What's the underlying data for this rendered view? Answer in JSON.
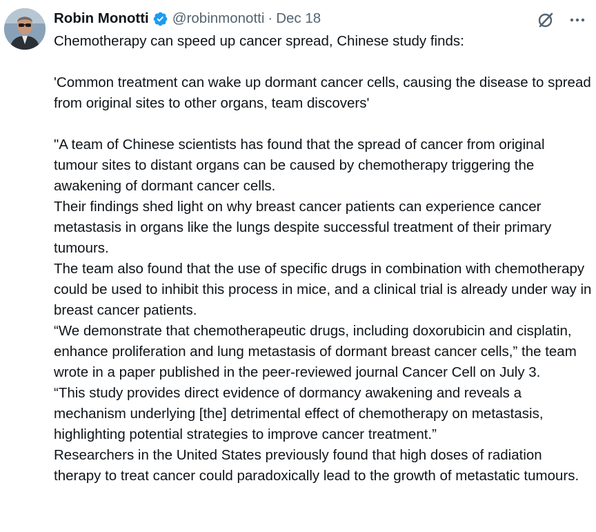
{
  "author": {
    "name": "Robin Monotti",
    "handle": "@robinmonotti",
    "separator": "·",
    "date": "Dec 18",
    "verified": true
  },
  "icons": {
    "verified": "verified-badge-icon",
    "grok": "grok-icon",
    "more": "more-options-icon"
  },
  "colors": {
    "text": "#0f1419",
    "secondary_text": "#536471",
    "verified_blue": "#1d9bf0"
  },
  "tweet": {
    "line1": "Chemotherapy can speed up cancer spread, Chinese study finds:",
    "line2": "'Common treatment can wake up dormant cancer cells, causing the disease to spread from original sites to other organs, team discovers'",
    "paragraphs": [
      "\"A team of Chinese scientists has found that the spread of cancer from original tumour sites to distant organs can be caused by chemotherapy triggering the awakening of dormant cancer cells.",
      "Their findings shed light on why breast cancer patients can experience cancer metastasis in organs like the lungs despite successful treatment of their primary tumours.",
      "The team also found that the use of specific drugs in combination with chemotherapy could be used to inhibit this process in mice, and a clinical trial is already under way in breast cancer patients.",
      "“We demonstrate that chemotherapeutic drugs, including doxorubicin and cisplatin, enhance proliferation and lung metastasis of dormant breast cancer cells,” the team wrote in a paper published in the peer-reviewed journal Cancer Cell on July 3.",
      "“This study provides direct evidence of dormancy awakening and reveals a mechanism underlying [the] detrimental effect of chemotherapy on metastasis, highlighting potential strategies to improve cancer treatment.”",
      "Researchers in the United States previously found that high doses of radiation therapy to treat cancer could paradoxically lead to the growth of metastatic tumours."
    ]
  }
}
